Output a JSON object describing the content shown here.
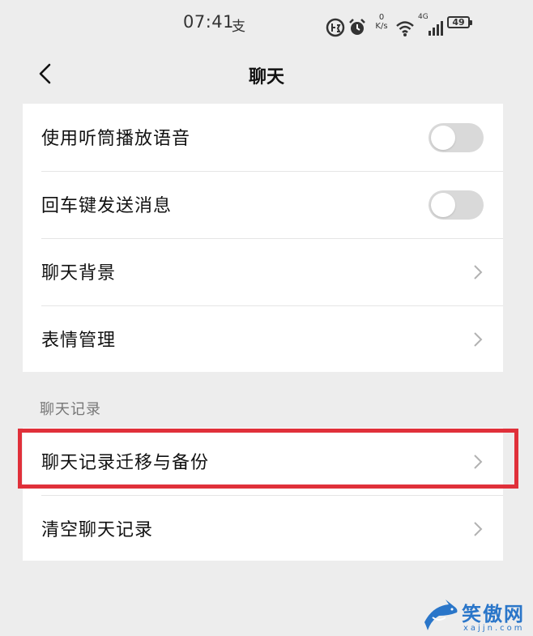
{
  "status_bar": {
    "time": "07:41",
    "pay_glyph": "支",
    "net_speed_value": "0",
    "net_speed_unit": "K/s",
    "network_type": "4G",
    "battery": "49",
    "icons": [
      "hd-voice-icon",
      "alarm-icon",
      "wifi-icon",
      "signal-icon",
      "battery-icon"
    ]
  },
  "header": {
    "back_icon": "chevron-left-icon",
    "title": "聊天"
  },
  "settings": {
    "items": [
      {
        "label": "使用听筒播放语音",
        "control": "toggle",
        "on": false
      },
      {
        "label": "回车键发送消息",
        "control": "toggle",
        "on": false
      },
      {
        "label": "聊天背景",
        "control": "chevron"
      },
      {
        "label": "表情管理",
        "control": "chevron"
      }
    ]
  },
  "chat_history": {
    "section_label": "聊天记录",
    "items": [
      {
        "label": "聊天记录迁移与备份",
        "control": "chevron",
        "highlighted": true
      },
      {
        "label": "清空聊天记录",
        "control": "chevron"
      }
    ]
  },
  "highlight_color": "#e0303a",
  "watermark": {
    "text": "笑傲网",
    "url": "xajjn.com"
  }
}
